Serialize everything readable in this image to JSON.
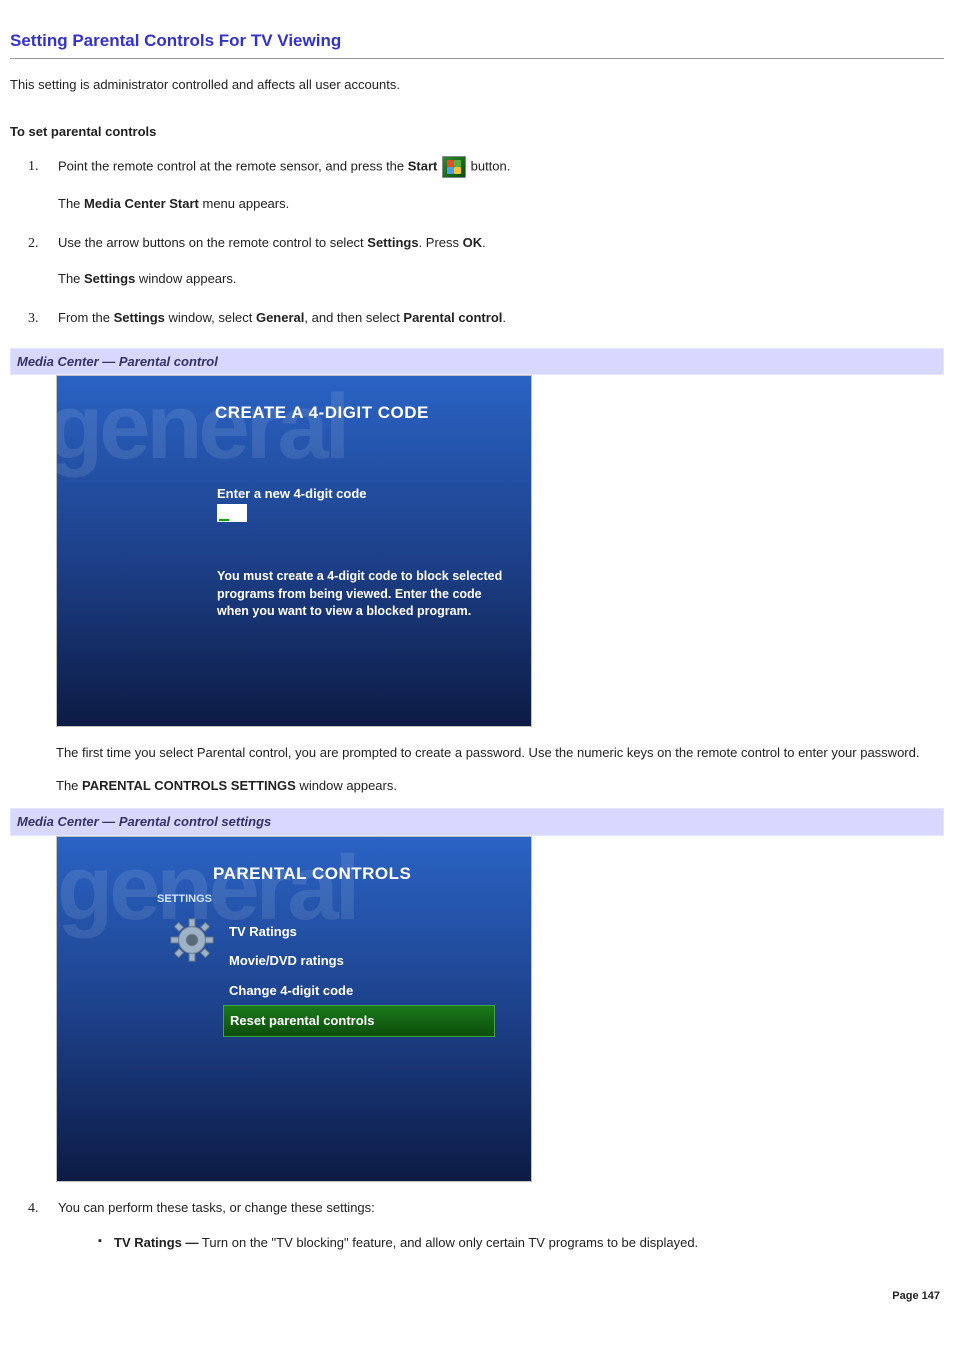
{
  "title": "Setting Parental Controls For TV Viewing",
  "intro": "This setting is administrator controlled and affects all user accounts.",
  "sublabel": "To set parental controls",
  "steps": {
    "n1": "1.",
    "s1a_pre": "Point the remote control at the remote sensor, and press the ",
    "s1a_bold": "Start",
    "s1a_post": " button.",
    "s1b_pre": "The ",
    "s1b_bold": "Media Center Start",
    "s1b_post": " menu appears.",
    "n2": "2.",
    "s2a_pre": "Use the arrow buttons on the remote control to select ",
    "s2a_b1": "Settings",
    "s2a_mid": ". Press ",
    "s2a_b2": "OK",
    "s2a_post": ".",
    "s2b_pre": "The ",
    "s2b_bold": "Settings",
    "s2b_post": " window appears.",
    "n3": "3.",
    "s3_pre": "From the ",
    "s3_b1": "Settings",
    "s3_mid1": " window, select ",
    "s3_b2": "General",
    "s3_mid2": ", and then select ",
    "s3_b3": "Parental control",
    "s3_post": "."
  },
  "caption1": "Media Center — Parental control",
  "mc1": {
    "ghost": "general",
    "header": "CREATE A 4-DIGIT CODE",
    "prompt": "Enter a new 4-digit code",
    "desc": "You must create a 4-digit code to block selected programs from being viewed. Enter the code when you want to view a blocked program."
  },
  "after1_a": "The first time you select Parental control, you are prompted to create a password. Use the numeric keys on the remote control to enter your password.",
  "after1_b_pre": "The ",
  "after1_b_bold": "PARENTAL CONTROLS SETTINGS",
  "after1_b_post": " window appears.",
  "caption2": "Media Center — Parental control settings",
  "mc2": {
    "ghost": "general",
    "settings_label": "SETTINGS",
    "header": "PARENTAL CONTROLS",
    "items": {
      "i0": "TV Ratings",
      "i1": "Movie/DVD ratings",
      "i2": "Change 4-digit code",
      "i3": "Reset parental controls"
    }
  },
  "n4": "4.",
  "s4": "You can perform these tasks, or change these settings:",
  "bullet1_bold": "TV Ratings —",
  "bullet1_rest": " Turn on the \"TV blocking\" feature, and allow only certain TV programs to be displayed.",
  "page_footer": "Page 147"
}
